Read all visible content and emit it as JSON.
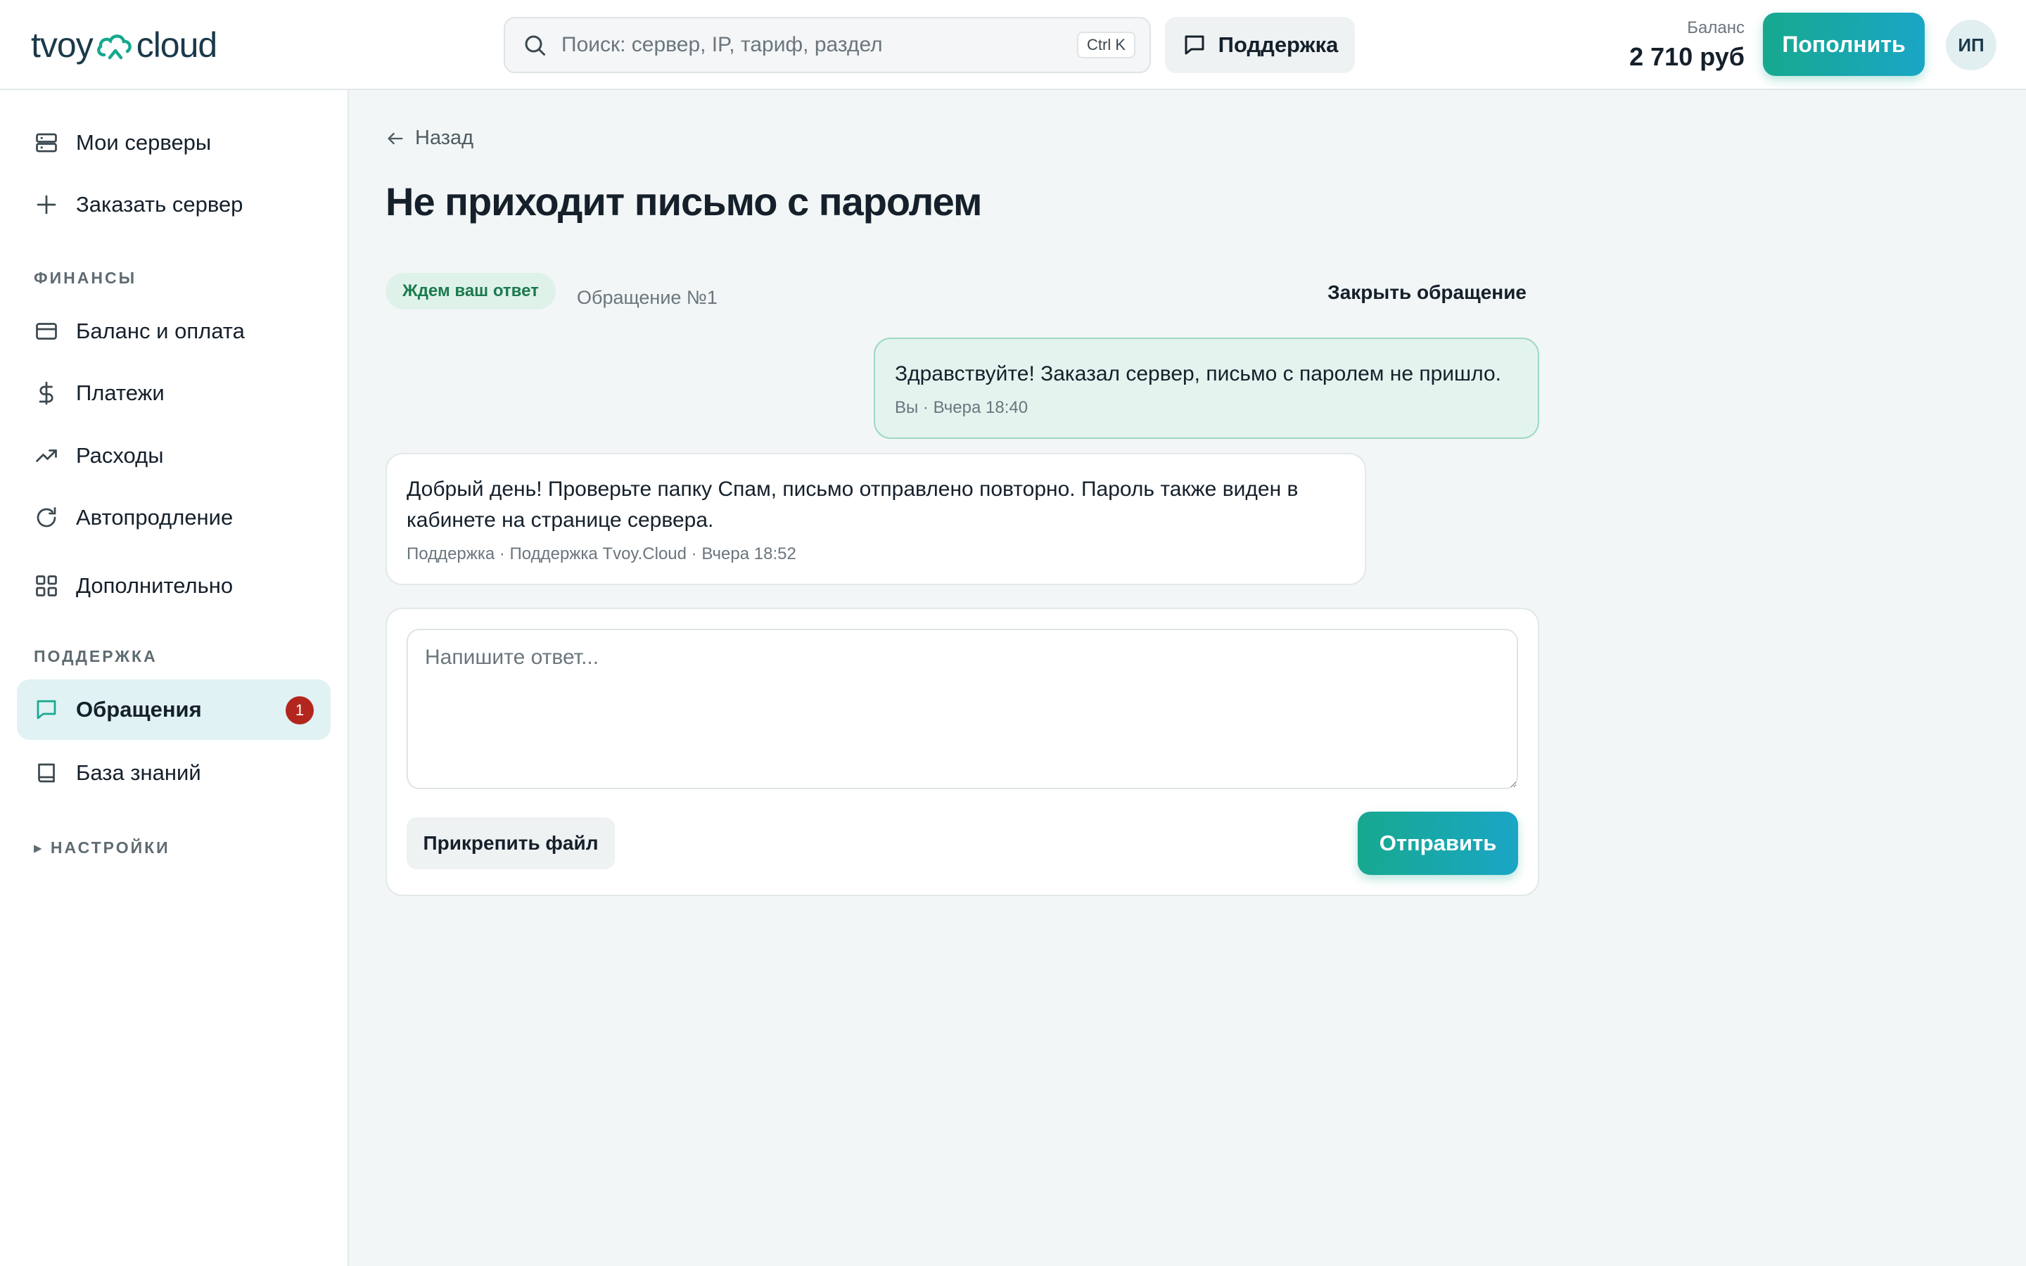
{
  "header": {
    "logo_left": "tvoy",
    "logo_right": "cloud",
    "search_placeholder": "Поиск: сервер, IP, тариф, раздел",
    "search_shortcut": "Ctrl K",
    "support_label": "Поддержка",
    "balance_label": "Баланс",
    "balance_value": "2 710 руб",
    "topup_label": "Пополнить",
    "avatar_initials": "ИП"
  },
  "sidebar": {
    "my_servers": "Мои серверы",
    "order_server": "Заказать сервер",
    "finance_title": "ФИНАНСЫ",
    "balance_payment": "Баланс и оплата",
    "payments": "Платежи",
    "expenses": "Расходы",
    "autorenew": "Автопродление",
    "more": "Дополнительно",
    "support_title": "ПОДДЕРЖКА",
    "tickets": "Обращения",
    "tickets_badge": "1",
    "knowledge_base": "База знаний",
    "settings_title": "▸ НАСТРОЙКИ"
  },
  "main": {
    "back_label": "Назад",
    "title": "Не приходит письмо с паролем",
    "status": "Ждем ваш ответ",
    "ticket_number": "Обращение №1",
    "close_label": "Закрыть обращение",
    "messages": [
      {
        "text": "Здравствуйте! Заказал сервер, письмо с паролем не пришло.",
        "meta": "Вы · Вчера 18:40"
      },
      {
        "text": "Добрый день! Проверьте папку Спам, письмо отправлено повторно. Пароль также виден в кабинете на странице сервера.",
        "meta": "Поддержка · Поддержка Tvoy.Cloud · Вчера 18:52"
      }
    ],
    "reply_placeholder": "Напишите ответ...",
    "attach_label": "Прикрепить файл",
    "send_label": "Отправить"
  },
  "colors": {
    "accent_start": "#17a88f",
    "accent_end": "#1aa6c6",
    "badge_red": "#b3261e",
    "status_green": "#1b7a4e"
  }
}
